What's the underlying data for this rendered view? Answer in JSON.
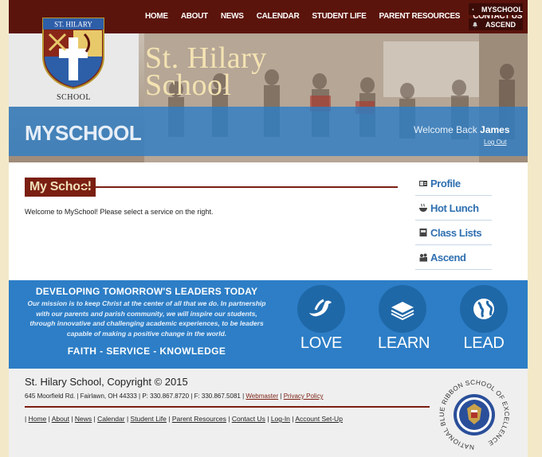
{
  "nav": {
    "items": [
      "HOME",
      "ABOUT",
      "NEWS",
      "CALENDAR",
      "STUDENT LIFE",
      "PARENT RESOURCES",
      "CONTACT US"
    ]
  },
  "utility": {
    "myschool": "MYSCHOOL",
    "ascend": "ASCEND"
  },
  "school": {
    "crest_banner": "ST. HILARY",
    "crest_caption": "SCHOOL",
    "hero_title": "St. Hilary School"
  },
  "band": {
    "title": "MYSCHOOL",
    "welcome_prefix": "Welcome Back",
    "user_name": "James",
    "logout": "Log Out"
  },
  "main": {
    "section_title": "My School",
    "intro": "Welcome to MySchool!  Please select a service on the right."
  },
  "services": [
    {
      "label": "Profile",
      "icon": "profile-icon"
    },
    {
      "label": "Hot Lunch",
      "icon": "food-bowl-icon"
    },
    {
      "label": "Class Lists",
      "icon": "book-icon"
    },
    {
      "label": "Ascend",
      "icon": "people-icon"
    }
  ],
  "mission": {
    "title": "DEVELOPING TOMORROW'S LEADERS TODAY",
    "text": "Our mission is to keep Christ at the center of all that we do. In partnership with our parents and parish community, we will inspire our students, through innovative and challenging academic experiences, to be leaders capable of making a positive change in the world.",
    "tagline": "FAITH - SERVICE - KNOWLEDGE",
    "pillars": [
      {
        "label": "LOVE",
        "icon": "dove-icon"
      },
      {
        "label": "LEARN",
        "icon": "book-icon"
      },
      {
        "label": "LEAD",
        "icon": "globe-icon"
      }
    ]
  },
  "footer": {
    "copyright": "St. Hilary School, Copyright © 2015",
    "address": "645 Moorfield Rd. | Fairlawn, OH 44333 | P: 330.867.8720 | F: 330.867.5081 |",
    "webmaster": "Webmaster",
    "privacy": "Privacy Policy",
    "links": [
      "Home",
      "About",
      "News",
      "Calendar",
      "Student Life",
      "Parent Resources",
      "Contact Us",
      "Log-In",
      "Account Set-Up"
    ],
    "ribbon_text": "NATIONAL BLUE RIBBON SCHOOL OF EXCELLENCE"
  },
  "colors": {
    "maroon": "#5b140c",
    "accent_red": "#7a1f12",
    "blue": "#2d7ec6",
    "link_blue": "#2e6fb0"
  }
}
